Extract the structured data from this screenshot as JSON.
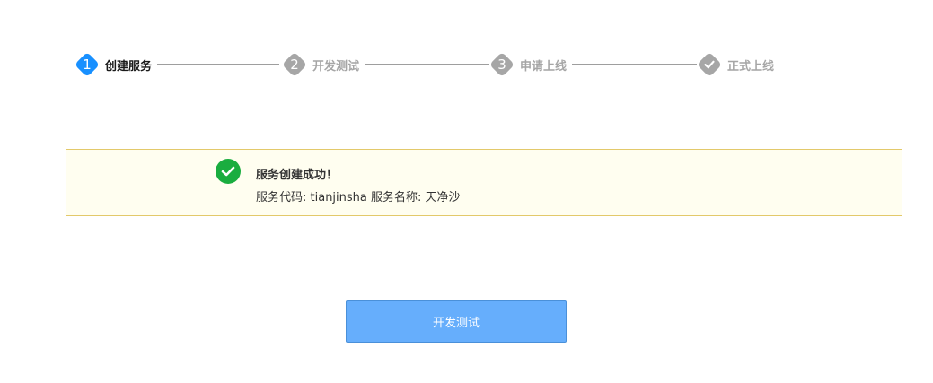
{
  "steps": [
    {
      "badge": "1",
      "label": "创建服务",
      "state": "active"
    },
    {
      "badge": "2",
      "label": "开发测试",
      "state": "pending"
    },
    {
      "badge": "3",
      "label": "申请上线",
      "state": "pending"
    },
    {
      "badge": "check-icon",
      "label": "正式上线",
      "state": "pending"
    }
  ],
  "alert": {
    "icon": "success-check-icon",
    "title": "服务创建成功！",
    "detail": "服务代码: tianjinsha 服务名称: 天净沙"
  },
  "action": {
    "label": "开发测试"
  },
  "colors": {
    "active_step": "#1890ff",
    "inactive_step": "#a6a6a6",
    "success": "#1aad3f",
    "alert_background": "#fffef0",
    "alert_border": "#e3c96a",
    "button_background": "#66aefc"
  }
}
